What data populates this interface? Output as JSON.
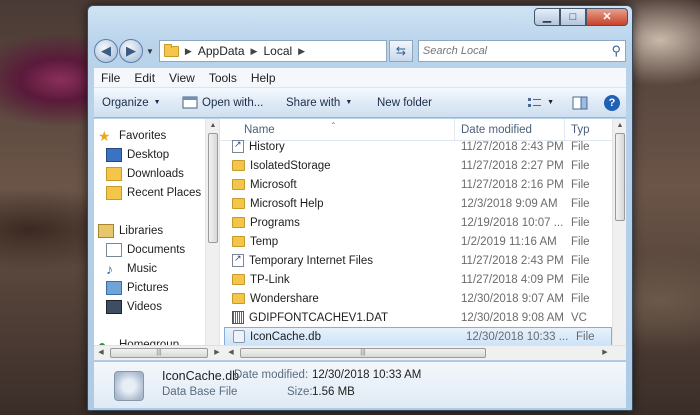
{
  "window": {
    "caption_buttons": {
      "minimize": "▁",
      "maximize": "□",
      "close": "✕"
    }
  },
  "address": {
    "crumbs": [
      "AppData",
      "Local"
    ],
    "search_placeholder": "Search Local"
  },
  "menu": [
    "File",
    "Edit",
    "View",
    "Tools",
    "Help"
  ],
  "toolbar": {
    "organize": "Organize",
    "open_with": "Open with...",
    "share_with": "Share with",
    "new_folder": "New folder"
  },
  "nav": {
    "favorites": "Favorites",
    "desktop": "Desktop",
    "downloads": "Downloads",
    "recent_places": "Recent Places",
    "libraries": "Libraries",
    "documents": "Documents",
    "music": "Music",
    "pictures": "Pictures",
    "videos": "Videos",
    "homegroup": "Homegroup"
  },
  "columns": {
    "name": "Name",
    "date": "Date modified",
    "type": "Typ"
  },
  "files": [
    {
      "name": "History",
      "date": "11/27/2018 2:43 PM",
      "type": "File",
      "icon": "shortcut-icon"
    },
    {
      "name": "IsolatedStorage",
      "date": "11/27/2018 2:27 PM",
      "type": "File",
      "icon": "folder-icon"
    },
    {
      "name": "Microsoft",
      "date": "11/27/2018 2:16 PM",
      "type": "File",
      "icon": "folder-icon"
    },
    {
      "name": "Microsoft Help",
      "date": "12/3/2018 9:09 AM",
      "type": "File",
      "icon": "folder-icon"
    },
    {
      "name": "Programs",
      "date": "12/19/2018 10:07 ...",
      "type": "File",
      "icon": "folder-icon"
    },
    {
      "name": "Temp",
      "date": "1/2/2019 11:16 AM",
      "type": "File",
      "icon": "folder-icon"
    },
    {
      "name": "Temporary Internet Files",
      "date": "11/27/2018 2:43 PM",
      "type": "File",
      "icon": "shortcut-icon"
    },
    {
      "name": "TP-Link",
      "date": "11/27/2018 4:09 PM",
      "type": "File",
      "icon": "folder-icon"
    },
    {
      "name": "Wondershare",
      "date": "12/30/2018 9:07 AM",
      "type": "File",
      "icon": "folder-icon"
    },
    {
      "name": "GDIPFONTCACHEV1.DAT",
      "date": "12/30/2018 9:08 AM",
      "type": "VC",
      "icon": "dat-file-icon"
    },
    {
      "name": "IconCache.db",
      "date": "12/30/2018 10:33 ...",
      "type": "File",
      "icon": "db-file-icon"
    }
  ],
  "selected_index": 10,
  "details": {
    "name": "IconCache.db",
    "date_label": "Date modified:",
    "date_value": "12/30/2018 10:33 AM",
    "type": "Data Base File",
    "size_label": "Size:",
    "size_value": "1.56 MB"
  }
}
